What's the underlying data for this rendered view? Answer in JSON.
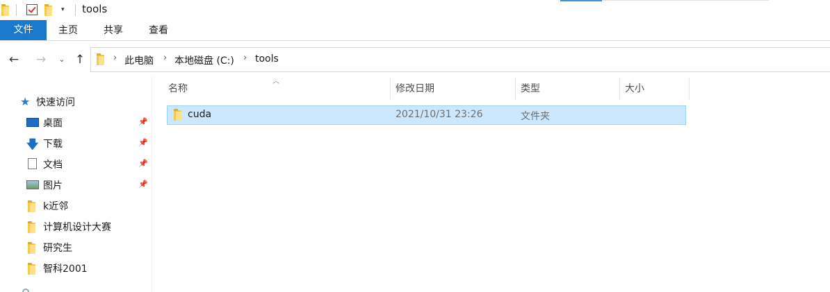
{
  "window": {
    "title": "tools"
  },
  "ribbon": {
    "file_tab": "文件",
    "tabs": [
      "主页",
      "共享",
      "查看"
    ]
  },
  "nav": {
    "back_icon": "arrow-left-icon",
    "forward_icon": "arrow-right-icon",
    "recent_icon": "chevron-down-icon",
    "up_icon": "arrow-up-icon"
  },
  "address": {
    "crumbs": [
      "此电脑",
      "本地磁盘 (C:)",
      "tools"
    ]
  },
  "sidebar": {
    "quick_access": "快速访问",
    "items": [
      {
        "label": "桌面",
        "icon": "desktop-icon",
        "pinned": true
      },
      {
        "label": "下载",
        "icon": "download-icon",
        "pinned": true
      },
      {
        "label": "文档",
        "icon": "document-icon",
        "pinned": true
      },
      {
        "label": "图片",
        "icon": "pictures-icon",
        "pinned": true
      },
      {
        "label": "k近邻",
        "icon": "folder-icon",
        "pinned": false
      },
      {
        "label": "计算机设计大赛",
        "icon": "folder-icon",
        "pinned": false
      },
      {
        "label": "研究生",
        "icon": "folder-icon",
        "pinned": false
      },
      {
        "label": "智科2001",
        "icon": "folder-icon",
        "pinned": false
      }
    ]
  },
  "table": {
    "columns": [
      "名称",
      "修改日期",
      "类型",
      "大小"
    ],
    "rows": [
      {
        "name": "cuda",
        "modified": "2021/10/31 23:26",
        "type": "文件夹",
        "size": ""
      }
    ]
  },
  "colors": {
    "accent": "#1979ca",
    "selection": "#cce8ff",
    "selection_border": "#99d1ff",
    "folder": "#f7c94a"
  }
}
